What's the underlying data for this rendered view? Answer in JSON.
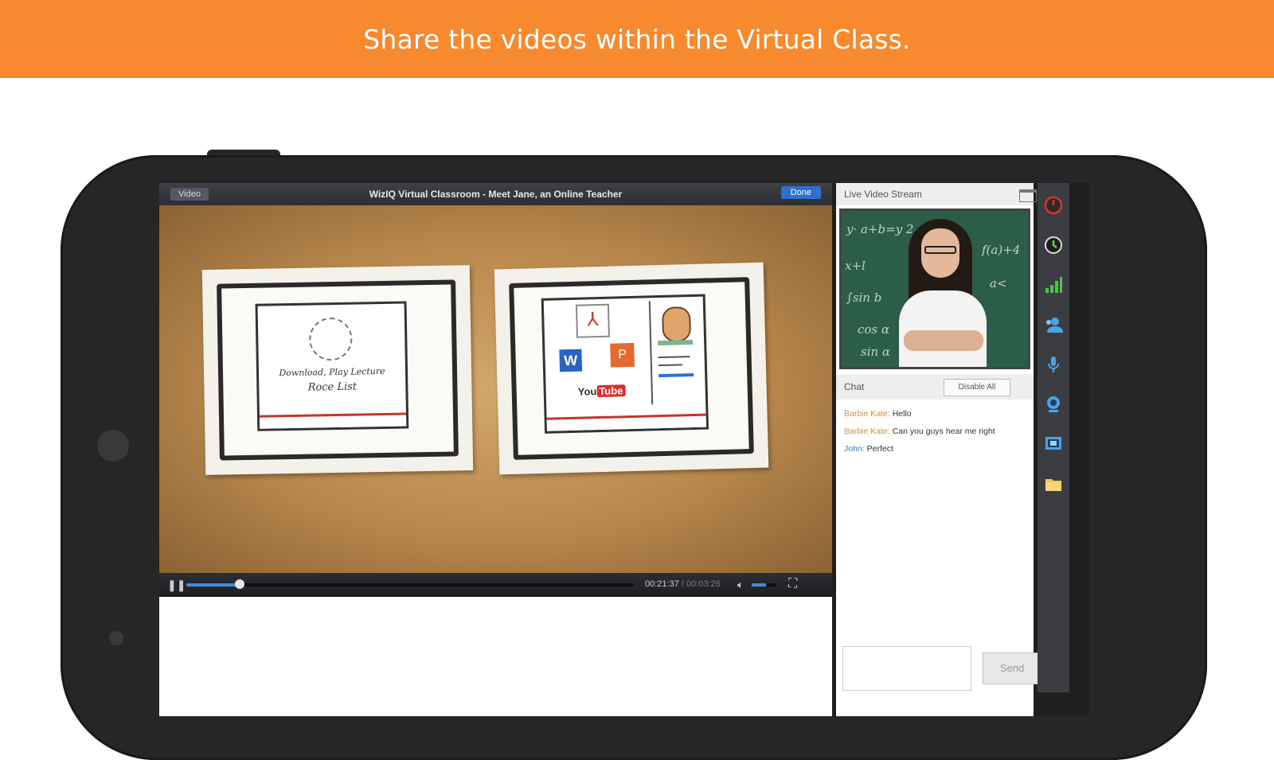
{
  "banner": {
    "text": "Share the videos within the Virtual Class."
  },
  "video": {
    "tab_label": "Video",
    "title": "WizIQ Virtual Classroom - Meet Jane, an Online Teacher",
    "done_label": "Done",
    "progress": 0.12,
    "elapsed": "00:21:37",
    "total": " / 00:03:26",
    "volume": 0.6,
    "card_left_line1": "Download, Play Lecture",
    "card_left_line2": "Roce List"
  },
  "live_stream": {
    "title": "Live Video Stream"
  },
  "chat": {
    "title": "Chat",
    "disable_label": "Disable All",
    "messages": [
      {
        "name": "Barbie Kate:",
        "text": " Hello"
      },
      {
        "name": "Barbie Kate:",
        "text": " Can you guys hear me right"
      },
      {
        "name": "John:",
        "text": " Perfect"
      }
    ],
    "send_label": "Send"
  },
  "toolbar": {
    "icons": [
      "power-icon",
      "clock-icon",
      "signal-icon",
      "users-icon",
      "microphone-icon",
      "webcam-icon",
      "screen-share-icon",
      "folder-icon"
    ]
  },
  "colors": {
    "accent": "#f7892e",
    "chat_name": "#f08a2d",
    "progress": "#3d8ddf"
  }
}
